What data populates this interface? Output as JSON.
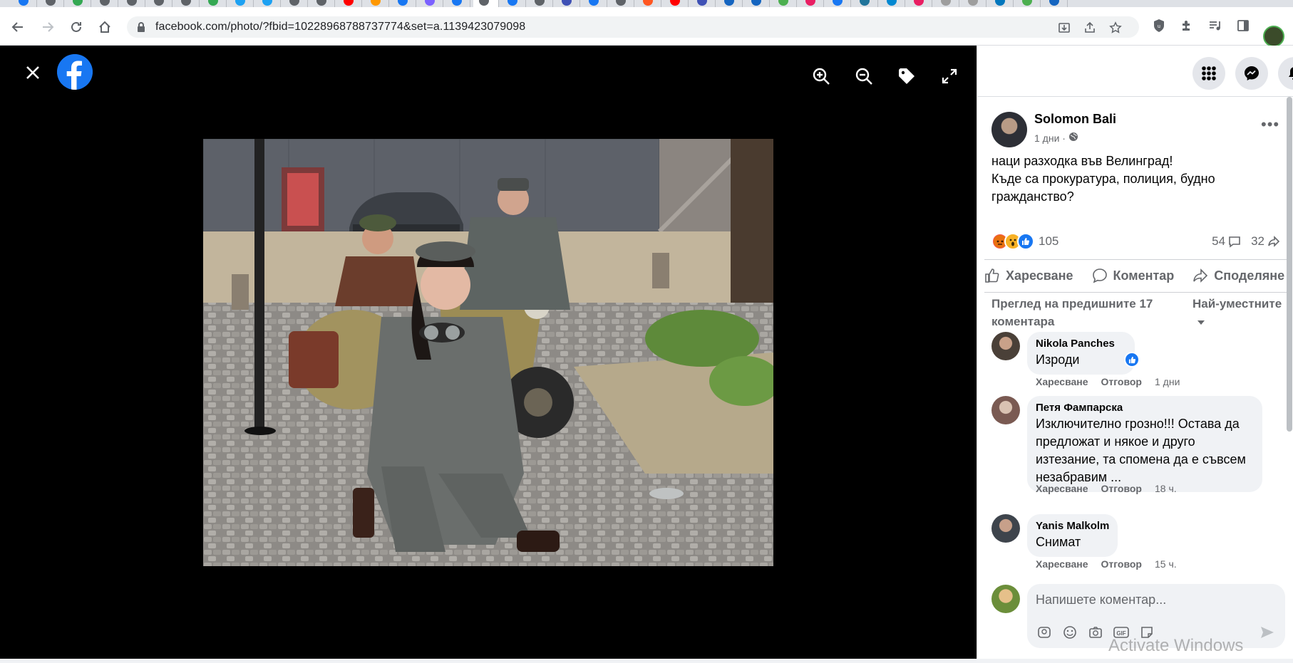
{
  "browser": {
    "url": "facebook.com/photo/?fbid=10228968788737774&set=a.1139423079098",
    "tab_icon_colors": [
      "#1877f2",
      "#5f6368",
      "#34a853",
      "#5f6368",
      "#5f6368",
      "#5f6368",
      "#5f6368",
      "#34a853",
      "#1da1f2",
      "#1da1f2",
      "#5f6368",
      "#5f6368",
      "#ff0000",
      "#ff9800",
      "#1877f2",
      "#7b61ff",
      "#1877f2",
      "#ffffff",
      "#1877f2",
      "#5f6368",
      "#3f51b5",
      "#1877f2",
      "#5f6368",
      "#ff5722",
      "#ff0000",
      "#3f51b5",
      "#1565c0",
      "#1565c0",
      "#4caf50",
      "#e91e63",
      "#1877f2",
      "#21759b",
      "#0288d1",
      "#e91e63",
      "#9e9e9e",
      "#9e9e9e",
      "#0277bd",
      "#4caf50",
      "#1565c0"
    ]
  },
  "post": {
    "author": "Solomon Bali",
    "time": "1 дни ·",
    "text_line1": "наци разходка във Велинград!",
    "text_line2": "Къде са прокуратура, полиция, будно гражданство?",
    "reactions_count": "105",
    "comments_count": "54",
    "shares_count": "32",
    "action_like": "Харесване",
    "action_comment": "Коментар",
    "action_share": "Споделяне",
    "view_previous": "Преглед на предишните 17 коментара",
    "sort_label": "Най-уместните"
  },
  "comments": [
    {
      "name": "Nikola Panches",
      "text": "Изроди",
      "like": "Харесване",
      "reply": "Отговор",
      "time": "1 дни"
    },
    {
      "name": "Петя Фампарска",
      "text": "Изключително грозно!!! Остава да предложат и някое и друго изтезание, та спомена да е съвсем незабравим ...",
      "like": "Харесване",
      "reply": "Отговор",
      "time": "18 ч."
    },
    {
      "name": "Yanis Malkolm",
      "text": "Снимат",
      "like": "Харесване",
      "reply": "Отговор",
      "time": "15 ч."
    }
  ],
  "composer": {
    "placeholder": "Напишете коментар..."
  },
  "watermark": "Activate Windows"
}
